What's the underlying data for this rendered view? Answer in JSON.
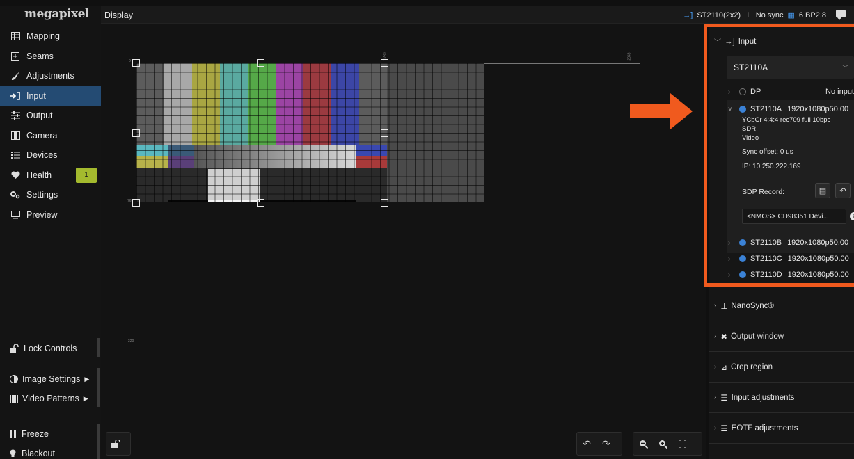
{
  "app": {
    "logo": "megapixel",
    "view_title": "Display"
  },
  "topbar": {
    "input_status": "ST2110(2x2)",
    "sync_status": "No sync",
    "processor": "6 BP2.8"
  },
  "sidebar": {
    "items": [
      {
        "label": "Mapping",
        "icon": "grid-icon"
      },
      {
        "label": "Seams",
        "icon": "plus-box-icon"
      },
      {
        "label": "Adjustments",
        "icon": "brush-icon"
      },
      {
        "label": "Input",
        "icon": "input-arrow-icon",
        "active": true
      },
      {
        "label": "Output",
        "icon": "sliders-icon"
      },
      {
        "label": "Camera",
        "icon": "film-icon"
      },
      {
        "label": "Devices",
        "icon": "list-icon"
      },
      {
        "label": "Health",
        "icon": "heart-icon",
        "badge": "1"
      },
      {
        "label": "Settings",
        "icon": "gears-icon"
      },
      {
        "label": "Preview",
        "icon": "monitor-icon"
      }
    ],
    "lock_controls": "Lock Controls",
    "image_settings": "Image Settings",
    "video_patterns": "Video Patterns",
    "freeze": "Freeze",
    "blackout": "Blackout"
  },
  "canvas": {
    "ruler_ticks": {
      "left_top": "0",
      "left_mid": "767",
      "left_bottom": "+320",
      "top_mid": "1280",
      "top_right": "2048"
    }
  },
  "panel": {
    "input": {
      "title": "Input",
      "selected_source": "ST2110A",
      "sources": [
        {
          "name": "DP",
          "format": "No input",
          "active": false
        },
        {
          "name": "ST2110A",
          "format": "1920x1080p50.00",
          "active": true,
          "expanded": true
        },
        {
          "name": "ST2110B",
          "format": "1920x1080p50.00",
          "active": true
        },
        {
          "name": "ST2110C",
          "format": "1920x1080p50.00",
          "active": true
        },
        {
          "name": "ST2110D",
          "format": "1920x1080p50.00",
          "active": true
        }
      ],
      "details": {
        "color": "YCbCr 4:4:4 rec709 full 10bpc",
        "range": "SDR",
        "type": "Video",
        "sync_offset": "Sync offset: 0 us",
        "ip": "IP: 10.250.222.169",
        "sdp_label": "SDP Record:",
        "nmos": "<NMOS> CD98351 Devi..."
      }
    },
    "sections": [
      {
        "title": "NanoSync®",
        "icon": "nanosync-icon"
      },
      {
        "title": "Output window",
        "icon": "output-window-icon"
      },
      {
        "title": "Crop region",
        "icon": "crop-icon"
      },
      {
        "title": "Input adjustments",
        "icon": "sliders-icon"
      },
      {
        "title": "EOTF adjustments",
        "icon": "sliders-icon"
      }
    ]
  },
  "colors": {
    "accent": "#244b73",
    "highlight": "#f05a1e",
    "dot": "#3b82d6",
    "badge": "#a4ba2e"
  }
}
